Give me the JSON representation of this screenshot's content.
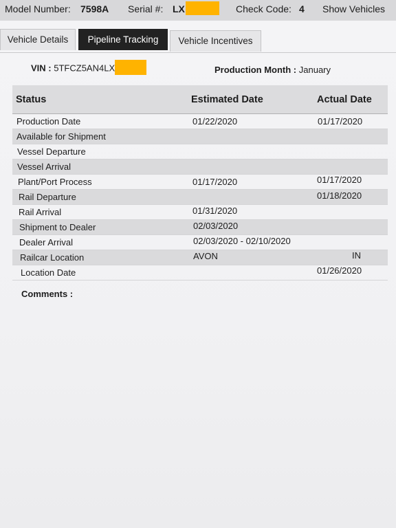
{
  "header": {
    "model_label": "Model Number:",
    "model_value": "7598A",
    "serial_label": "Serial #:",
    "serial_value": "LX",
    "check_label": "Check Code:",
    "check_value": "4",
    "show_vehicles_label": "Show Vehicles",
    "redaction_color": "#ffb300"
  },
  "tabs": [
    {
      "label": "Vehicle Details",
      "active": false
    },
    {
      "label": "Pipeline Tracking",
      "active": true
    },
    {
      "label": "Vehicle Incentives",
      "active": false
    }
  ],
  "vin": {
    "label": "VIN :",
    "value": "5TFCZ5AN4LX"
  },
  "production_month": {
    "label": "Production Month :",
    "value": "January"
  },
  "table": {
    "columns": [
      "Status",
      "Estimated Date",
      "Actual Date"
    ],
    "rows": [
      {
        "status": "Production Date",
        "estimated": "01/22/2020",
        "actual": "01/17/2020"
      },
      {
        "status": "Available for Shipment",
        "estimated": "",
        "actual": ""
      },
      {
        "status": "Vessel Departure",
        "estimated": "",
        "actual": ""
      },
      {
        "status": "Vessel Arrival",
        "estimated": "",
        "actual": ""
      },
      {
        "status": "Plant/Port Process",
        "estimated": "01/17/2020",
        "actual": "01/17/2020"
      },
      {
        "status": "Rail Departure",
        "estimated": "",
        "actual": "01/18/2020"
      },
      {
        "status": "Rail Arrival",
        "estimated": "01/31/2020",
        "actual": ""
      },
      {
        "status": "Shipment to Dealer",
        "estimated": "02/03/2020",
        "actual": ""
      },
      {
        "status": "Dealer Arrival",
        "estimated": "02/03/2020 - 02/10/2020",
        "actual": ""
      },
      {
        "status": "Railcar Location",
        "estimated": "AVON",
        "actual": "IN"
      },
      {
        "status": "Location Date",
        "estimated": "",
        "actual": "01/26/2020"
      }
    ]
  },
  "comments": {
    "label": "Comments :"
  },
  "colors": {
    "active_tab": "#222222",
    "row_alt": "#dadadc",
    "header_bg": "#dcdcde"
  }
}
